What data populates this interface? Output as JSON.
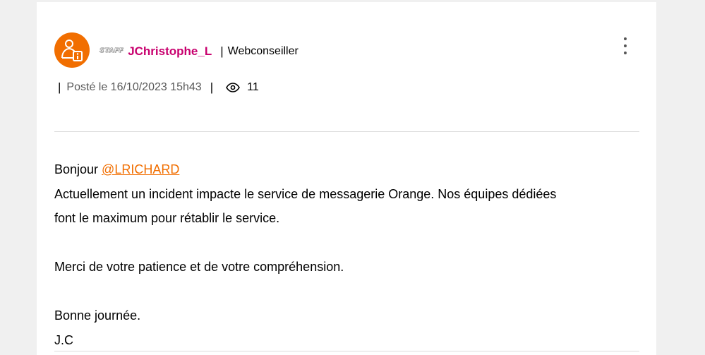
{
  "post": {
    "author": {
      "badge": "STAFF",
      "name": "JChristophe_L",
      "separator": "|",
      "role": "Webconseiller",
      "avatar_icon": "staff-user-icon"
    },
    "meta": {
      "posted": "Posté le 16/10/2023 15h43",
      "views_icon": "eye-icon",
      "views": "11"
    },
    "menu_icon": "kebab-menu-icon",
    "body": {
      "greeting": "Bonjour ",
      "mention": "@LRICHARD",
      "line1": "Actuellement un incident impacte le service de messagerie Orange. Nos équipes dédiées",
      "line2": "font le maximum pour rétablir le service.",
      "line3": "Merci de votre patience et de votre compréhension.",
      "line4": "Bonne journée.",
      "signature": "J.C"
    }
  },
  "colors": {
    "accent": "#f16e00",
    "author": "#c8006e",
    "page_bg": "#f0f0f0",
    "card_bg": "#ffffff"
  }
}
